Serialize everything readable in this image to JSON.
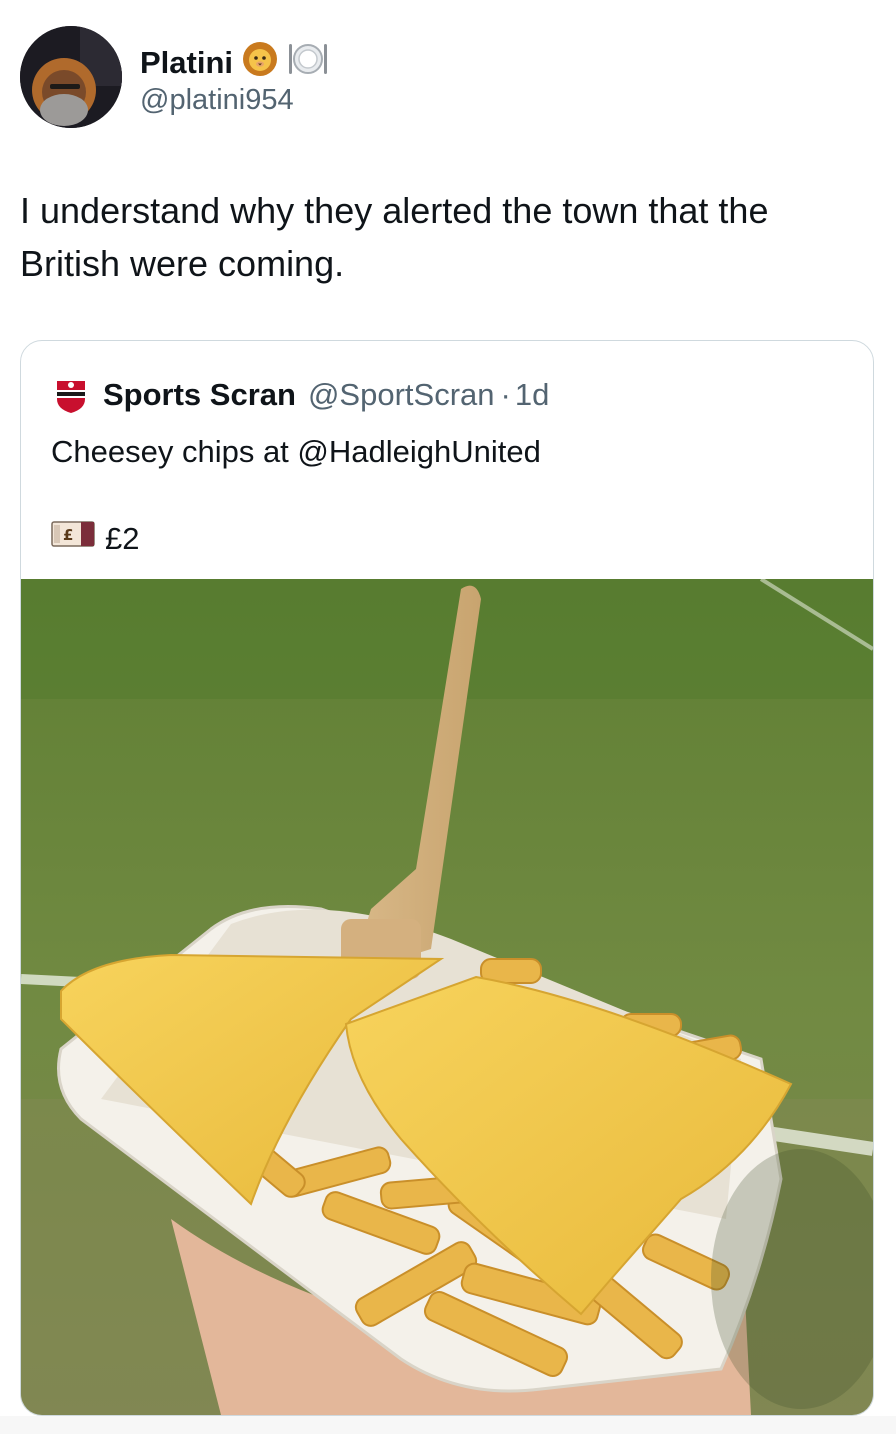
{
  "author": {
    "name": "Platini",
    "emojis": [
      "lion-emoji",
      "plate-emoji"
    ],
    "handle": "@platini954"
  },
  "tweet": {
    "text": "I understand why they alerted the town that the British were coming."
  },
  "quoted_tweet": {
    "name": "Sports Scran",
    "handle": "@SportScran",
    "separator": "·",
    "time": "1d",
    "text": "Cheesey chips at @HadleighUnited",
    "price_icon": "banknote-pound-icon",
    "price": "£2"
  },
  "colors": {
    "text": "#0f1419",
    "secondary": "#536471",
    "border": "#cfd9de",
    "grass": "#6f8a3e",
    "cheese": "#f1c94a",
    "chips": "#e9b64a",
    "tray": "#f4f1ea"
  }
}
